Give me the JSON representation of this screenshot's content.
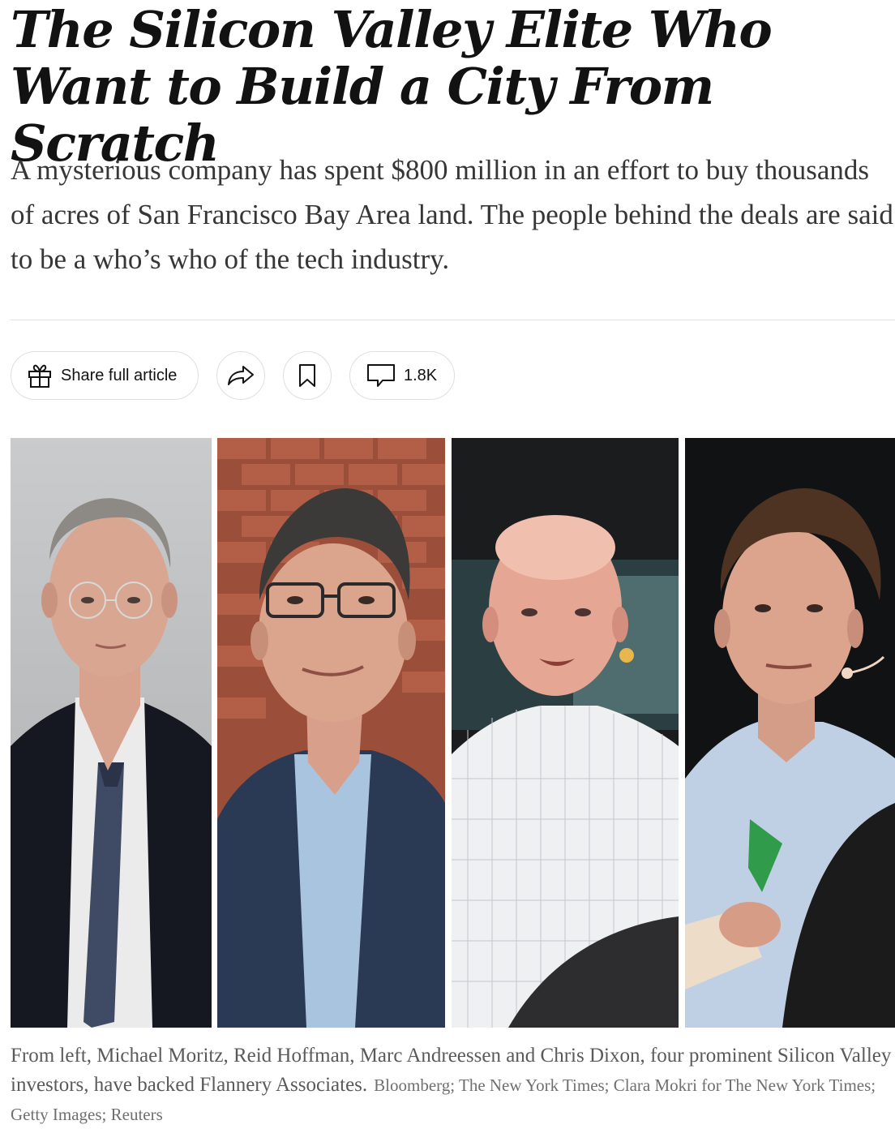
{
  "article": {
    "headline": "The Silicon Valley Elite Who Want to Build a City From Scratch",
    "summary": "A mysterious company has spent $800 million in an effort to buy thousands of acres of San Francisco Bay Area land. The people behind the deals are said to be a who’s who of the tech industry."
  },
  "toolbar": {
    "share_label": "Share full article",
    "share_icon": "gift-icon",
    "forward_icon": "share-arrow-icon",
    "save_icon": "bookmark-icon",
    "comments_icon": "comment-bubble-icon",
    "comments_count": "1.8K"
  },
  "photos": [
    {
      "icon": "portrait-photo"
    },
    {
      "icon": "portrait-photo"
    },
    {
      "icon": "portrait-photo"
    },
    {
      "icon": "portrait-photo"
    }
  ],
  "caption": {
    "text": "From left, Michael Moritz, Reid Hoffman, Marc Andreessen and Chris Dixon, four prominent Silicon Valley investors, have backed Flannery Associates.",
    "credit": "Bloomberg; The New York Times; Clara Mokri for The New York Times; Getty Images; Reuters"
  },
  "colors": {
    "text": "#121212",
    "summary": "#363636",
    "caption": "#5a5a5a",
    "border": "#dfdfdf"
  }
}
